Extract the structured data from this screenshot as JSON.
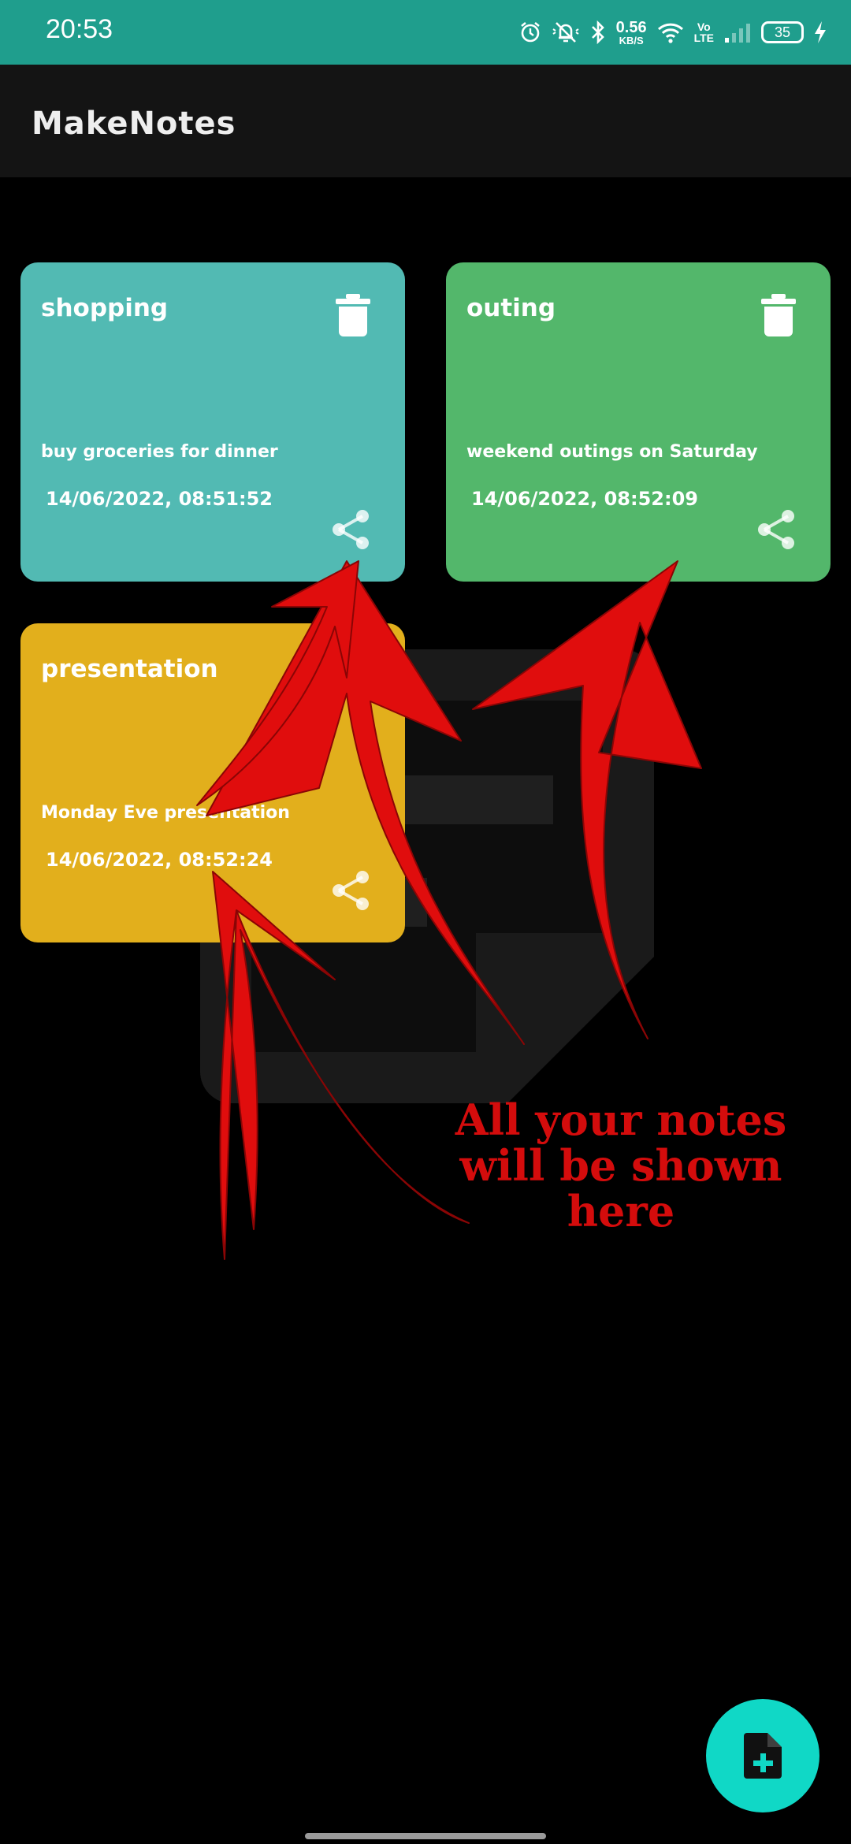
{
  "status_bar": {
    "time": "20:53",
    "net_speed_value": "0.56",
    "net_speed_unit": "KB/S",
    "volte_top": "Vo",
    "volte_bottom": "LTE",
    "battery": "35",
    "color": "#1f9e8d"
  },
  "app_bar": {
    "title": "MakeNotes"
  },
  "notes": [
    {
      "title": "shopping",
      "description": "buy groceries for dinner",
      "timestamp": "14/06/2022, 08:51:52",
      "color": "#52bab3"
    },
    {
      "title": "outing",
      "description": "weekend outings on Saturday",
      "timestamp": "14/06/2022, 08:52:09",
      "color": "#53b76b"
    },
    {
      "title": "presentation",
      "description": "Monday Eve presentation",
      "timestamp": "14/06/2022, 08:52:24",
      "color": "#e2af1c"
    }
  ],
  "annotation": {
    "line1": "All your notes",
    "line2": "will be shown",
    "line3": "here",
    "color": "#d40c0c"
  },
  "fab": {
    "icon": "add-note-icon",
    "color": "#10d8c6"
  },
  "icons": {
    "delete": "trash-icon",
    "share": "share-icon"
  }
}
